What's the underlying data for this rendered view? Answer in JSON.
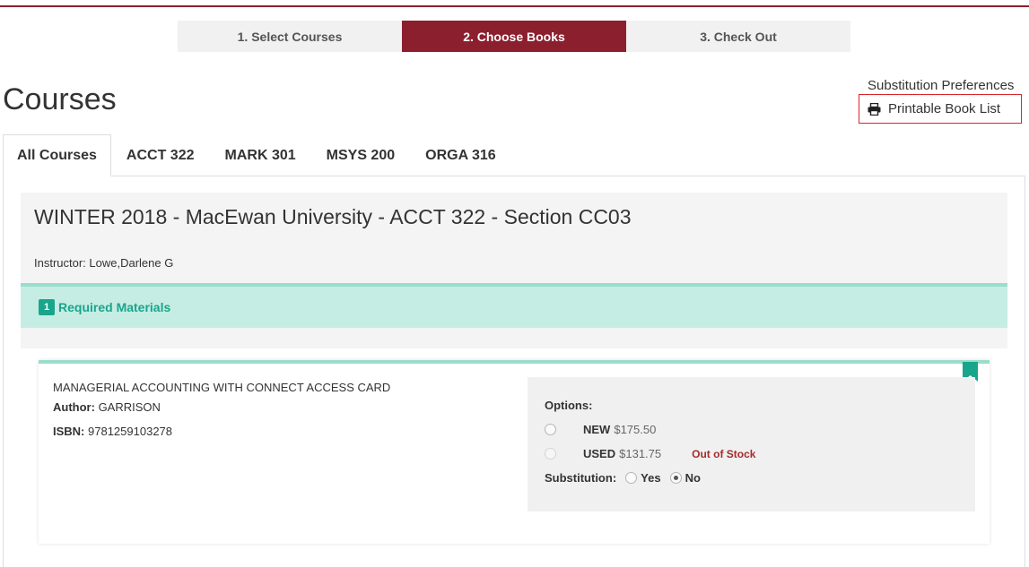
{
  "steps": [
    {
      "label": "1. Select Courses",
      "active": false
    },
    {
      "label": "2. Choose Books",
      "active": true
    },
    {
      "label": "3. Check Out",
      "active": false
    }
  ],
  "page_title": "Courses",
  "links": {
    "substitution_preferences": "Substitution Preferences",
    "printable_book_list": "Printable Book List"
  },
  "tabs": [
    {
      "label": "All Courses",
      "active": true
    },
    {
      "label": "ACCT 322",
      "active": false
    },
    {
      "label": "MARK 301",
      "active": false
    },
    {
      "label": "MSYS 200",
      "active": false
    },
    {
      "label": "ORGA 316",
      "active": false
    }
  ],
  "course": {
    "title": "WINTER 2018 - MacEwan University - ACCT 322 - Section CC03",
    "instructor": "Instructor: Lowe,Darlene G",
    "required": {
      "count": "1",
      "label": "Required Materials"
    }
  },
  "book": {
    "title": "MANAGERIAL ACCOUNTING WITH CONNECT ACCESS CARD",
    "author_label": "Author:",
    "author": "GARRISON",
    "isbn_label": "ISBN:",
    "isbn": "9781259103278",
    "options_label": "Options:",
    "options": [
      {
        "condition": "NEW",
        "price": "$175.50",
        "status": "",
        "disabled": false
      },
      {
        "condition": "USED",
        "price": "$131.75",
        "status": "Out of Stock",
        "disabled": true
      }
    ],
    "substitution_label": "Substitution:",
    "substitution_yes": "Yes",
    "substitution_no": "No",
    "substitution_selected": "No"
  },
  "colors": {
    "brand": "#8b1f2e",
    "accent_teal": "#19a58b",
    "teal_bg": "#c5ede4",
    "out_of_stock": "#a32c2c"
  }
}
